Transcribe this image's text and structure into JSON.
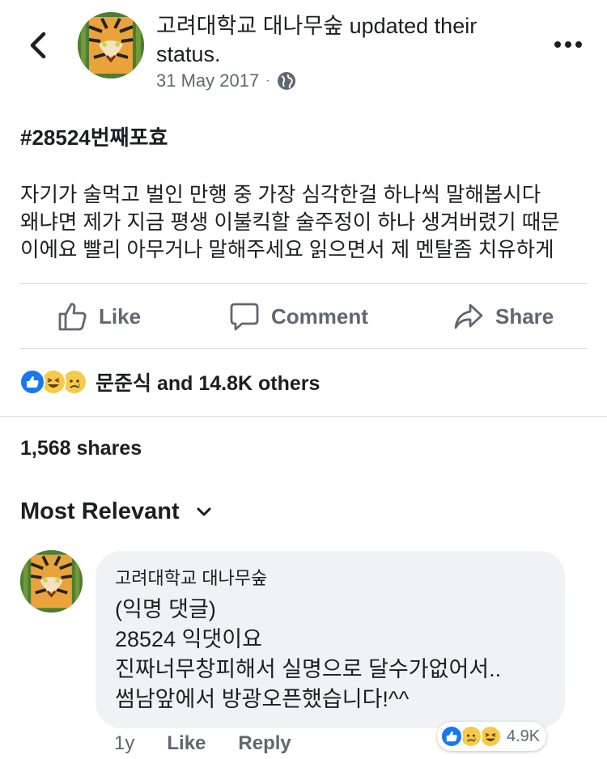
{
  "header": {
    "page_name": "고려대학교 대나무숲",
    "action_text": "updated their status.",
    "date": "31 May 2017",
    "dot": "·",
    "privacy_icon": "globe-icon"
  },
  "post": {
    "hashtag": "#28524번째포효",
    "lines": [
      "자기가 술먹고 벌인 만행 중 가장 심각한걸 하나씩 말해봅시다",
      "왜냐면 제가 지금 평생 이불킥할 술주정이 하나 생겨버렸기 때문",
      "이에요 빨리 아무거나 말해주세요 읽으면서 제 멘탈좀 치유하게"
    ]
  },
  "actions": {
    "like": "Like",
    "comment": "Comment",
    "share": "Share"
  },
  "reactions": {
    "icons": [
      "like-icon",
      "haha-icon",
      "sad-icon"
    ],
    "summary": "문준식 and 14.8K others"
  },
  "shares": "1,568 shares",
  "sort": {
    "label": "Most Relevant"
  },
  "comment": {
    "author": "고려대학교 대나무숲",
    "lines": [
      "(익명 댓글)",
      "28524 익댓이요",
      "진짜너무창피해서 실명으로 달수가없어서..",
      "썸남앞에서 방광오픈했습니다!^^"
    ],
    "time": "1y",
    "like": "Like",
    "reply": "Reply",
    "reaction_count": "4.9K"
  },
  "colors": {
    "like_blue": "#1877f2",
    "emoji_yellow": "#f7c948",
    "meta_gray": "#606770",
    "bubble_bg": "#f0f2f5"
  }
}
